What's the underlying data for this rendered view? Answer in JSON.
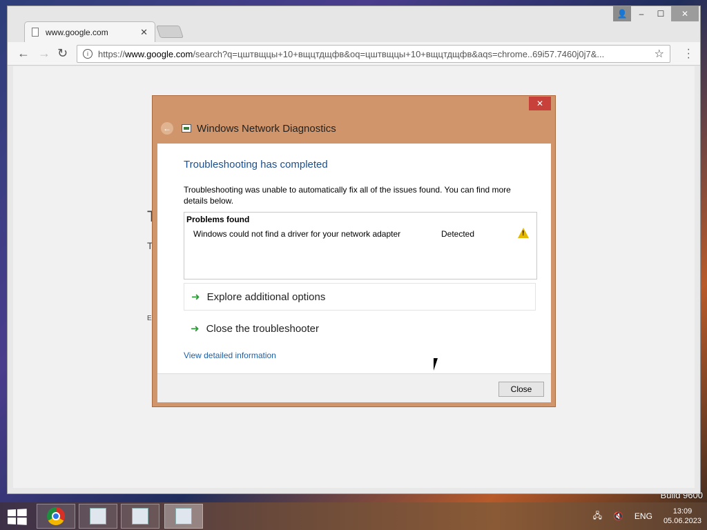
{
  "desktop": {
    "build_text": "Build 9600"
  },
  "browser": {
    "tab_title": "www.google.com",
    "url_prefix": "https://",
    "url_host": "www.google.com",
    "url_rest": "/search?q=цштвщцы+10+вщцтдщфв&oq=цштвщцы+10+вщцтдщфв&aqs=chrome..69i57.7460j0j7&...",
    "page_fragments": [
      "T",
      "T",
      "E"
    ]
  },
  "dialog": {
    "title": "Windows Network Diagnostics",
    "heading": "Troubleshooting has completed",
    "description": "Troubleshooting was unable to automatically fix all of the issues found. You can find more details below.",
    "problems_header": "Problems found",
    "problems": [
      {
        "issue": "Windows could not find a driver for your network adapter",
        "status": "Detected",
        "icon": "warning-icon"
      }
    ],
    "options": [
      "Explore additional options",
      "Close the troubleshooter"
    ],
    "detail_link": "View detailed information",
    "close_label": "Close"
  },
  "taskbar": {
    "language": "ENG",
    "time": "13:09",
    "date": "05.06.2023",
    "apps": [
      "chrome-icon",
      "network-icon",
      "files-icon",
      "diagnostics-icon"
    ]
  }
}
